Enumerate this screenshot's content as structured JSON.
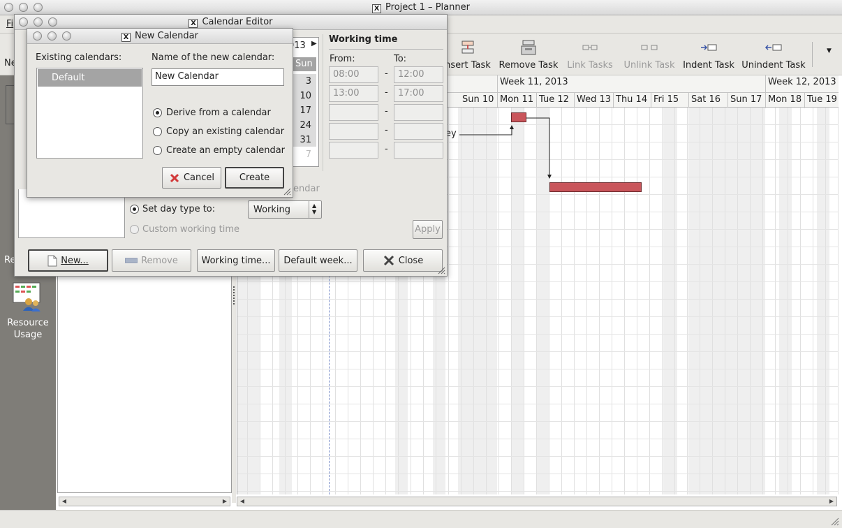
{
  "main_window": {
    "title": "Project 1 – Planner",
    "menu_first": "Fi",
    "toolbar_edge_label": "Ne",
    "toolbar": [
      {
        "label": "nsert Task",
        "icon": "insert-task-icon",
        "enabled": true
      },
      {
        "label": "Remove Task",
        "icon": "remove-task-icon",
        "enabled": true
      },
      {
        "label": "Link Tasks",
        "icon": "link-tasks-icon",
        "enabled": false
      },
      {
        "label": "Unlink Task",
        "icon": "unlink-task-icon",
        "enabled": false
      },
      {
        "label": "Indent Task",
        "icon": "indent-task-icon",
        "enabled": true
      },
      {
        "label": "Unindent Task",
        "icon": "unindent-task-icon",
        "enabled": true
      }
    ],
    "sidebar": {
      "partial_label": "Re",
      "resource_usage_label": "Resource Usage"
    }
  },
  "gantt": {
    "weeks": [
      "Week 11, 2013",
      "Week 12, 2013"
    ],
    "days": [
      "Sun 10",
      "Mon 11",
      "Tue 12",
      "Wed 13",
      "Thu 14",
      "Fri 15",
      "Sat 16",
      "Sun 17",
      "Mon 18",
      "Tue 19"
    ],
    "partial_task_label": "ey",
    "bar_color": "#c9555b"
  },
  "calendar_editor": {
    "title": "Calendar Editor",
    "month_header_partial": "013",
    "sun_header": "Sun",
    "sun_column": [
      "3",
      "10",
      "17",
      "24",
      "31",
      "7"
    ],
    "working_time": {
      "heading": "Working time",
      "from_label": "From:",
      "to_label": "To:",
      "rows": [
        {
          "from": "08:00",
          "to": "12:00"
        },
        {
          "from": "13:00",
          "to": "17:00"
        },
        {
          "from": "",
          "to": ""
        },
        {
          "from": "",
          "to": ""
        },
        {
          "from": "",
          "to": ""
        }
      ],
      "dash": "-"
    },
    "partial_calendar_text": "endar",
    "set_day_type_label": "Set day type to:",
    "day_type_value": "Working",
    "custom_working_time_label": "Custom working time",
    "apply_label": "Apply",
    "buttons": {
      "new": "New...",
      "remove": "Remove",
      "working_time": "Working time...",
      "default_week": "Default week...",
      "close": "Close"
    }
  },
  "new_calendar": {
    "title": "New Calendar",
    "existing_label": "Existing calendars:",
    "existing_items": [
      "Default"
    ],
    "name_label": "Name of the new calendar:",
    "name_value": "New Calendar",
    "options": [
      {
        "label": "Derive from a calendar",
        "selected": true
      },
      {
        "label": "Copy an existing calendar",
        "selected": false
      },
      {
        "label": "Create an empty calendar",
        "selected": false
      }
    ],
    "cancel": "Cancel",
    "create": "Create"
  }
}
